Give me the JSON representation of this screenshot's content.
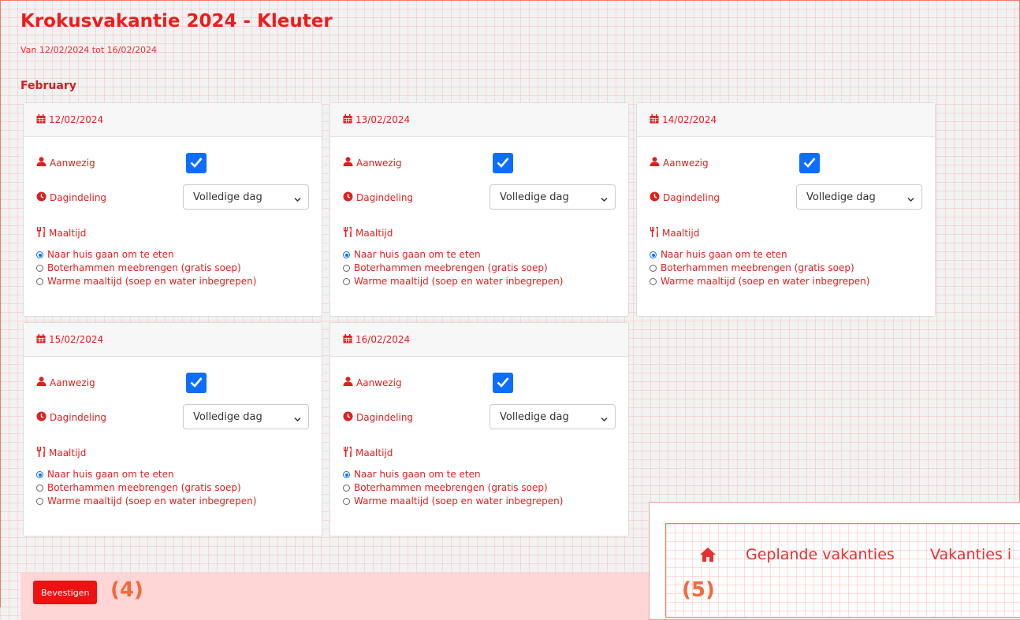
{
  "page": {
    "title": "Krokusvakantie 2024 - Kleuter",
    "period": "Van 12/02/2024 tot 16/02/2024",
    "month": "February"
  },
  "labels": {
    "present": "Aanwezig",
    "schedule": "Dagindeling",
    "meal": "Maaltijd"
  },
  "schedule_options": [
    "Volledige dag"
  ],
  "meal_options": [
    "Naar huis gaan om te eten",
    "Boterhammen meebrengen (gratis soep)",
    "Warme maaltijd (soep en water inbegrepen)"
  ],
  "days": [
    {
      "date": "12/02/2024",
      "present": true,
      "schedule": "Volledige dag",
      "meal": "Naar huis gaan om te eten"
    },
    {
      "date": "13/02/2024",
      "present": true,
      "schedule": "Volledige dag",
      "meal": "Naar huis gaan om te eten"
    },
    {
      "date": "14/02/2024",
      "present": true,
      "schedule": "Volledige dag",
      "meal": "Naar huis gaan om te eten"
    },
    {
      "date": "15/02/2024",
      "present": true,
      "schedule": "Volledige dag",
      "meal": "Naar huis gaan om te eten"
    },
    {
      "date": "16/02/2024",
      "present": true,
      "schedule": "Volledige dag",
      "meal": "Naar huis gaan om te eten"
    }
  ],
  "actions": {
    "confirm": "Bevestigen"
  },
  "annotations": {
    "step4": "(4)",
    "step5": "(5)"
  },
  "nav": {
    "home_icon": "home-icon",
    "items": [
      "Geplande vakanties",
      "Vakanties i"
    ]
  },
  "colors": {
    "accent": "#ee1c1c",
    "checkbox": "#0d6efd",
    "annotation": "#f26a3d",
    "confirm_bar": "#ffd6d6"
  }
}
